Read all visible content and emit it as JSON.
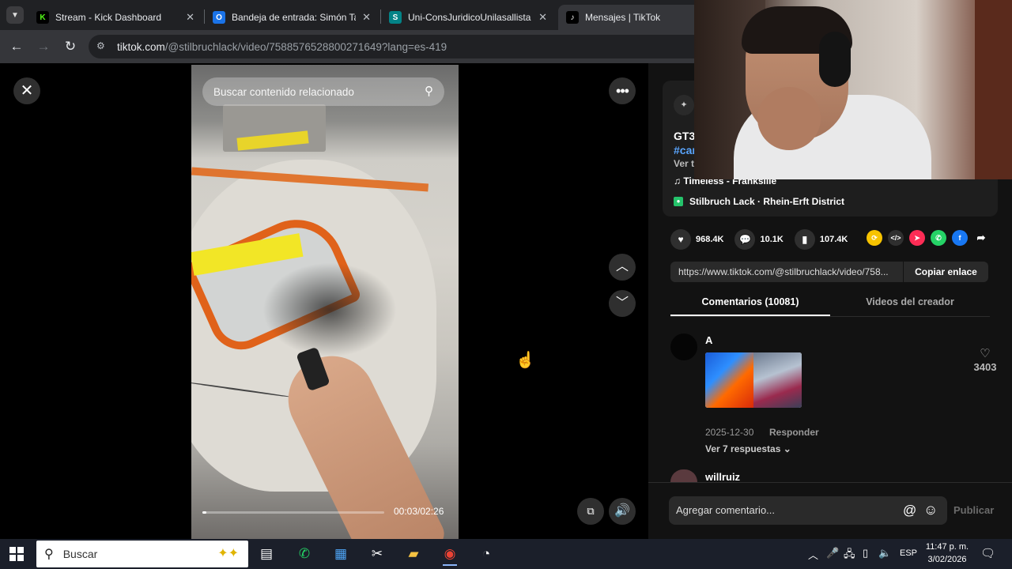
{
  "browser": {
    "tabs": [
      {
        "label": "Stream - Kick Dashboard",
        "icon": "kick-icon",
        "color": "#53fc18"
      },
      {
        "label": "Bandeja de entrada: Simón Tab",
        "icon": "outlook-icon",
        "color": "#1a73e8"
      },
      {
        "label": "Uni-ConsJuridicoUnilasallista - C",
        "icon": "sharepoint-icon",
        "color": "#038387"
      },
      {
        "label": "Mensajes | TikTok",
        "icon": "tiktok-icon",
        "color": "#ffffff"
      }
    ],
    "url_host": "tiktok.com",
    "url_path": "/@stilbruchlack/video/7588576528800271649?lang=es-419"
  },
  "video": {
    "search_placeholder": "Buscar contenido relacionado",
    "time": "00:03/02:26",
    "progress_fraction": 0.02
  },
  "caption": {
    "title": "GT3",
    "hashtag": "#car",
    "more": "Ver t",
    "music": "♫  Timeless - Frankslile",
    "location": "Stilbruch Lack · Rhein-Erft District"
  },
  "stats": {
    "likes": "968.4K",
    "comments": "10.1K",
    "saves": "107.4K"
  },
  "share": {
    "link": "https://www.tiktok.com/@stilbruchlack/video/758...",
    "copy_label": "Copiar enlace"
  },
  "panel_tabs": [
    {
      "label": "Comentarios (10081)",
      "active": true
    },
    {
      "label": "Videos del creador",
      "active": false
    }
  ],
  "comments": [
    {
      "user": "A ",
      "date": "2025-12-30",
      "reply": "Responder",
      "replies": "Ver 7 respuestas ⌄",
      "likes": "3403"
    },
    {
      "user": "willruiz"
    }
  ],
  "composer": {
    "placeholder": "Agregar comentario...",
    "post_label": "Publicar"
  },
  "taskbar": {
    "search_label": "Buscar",
    "language": "ESP",
    "time": "11:47 p. m.",
    "date": "3/02/2026"
  }
}
